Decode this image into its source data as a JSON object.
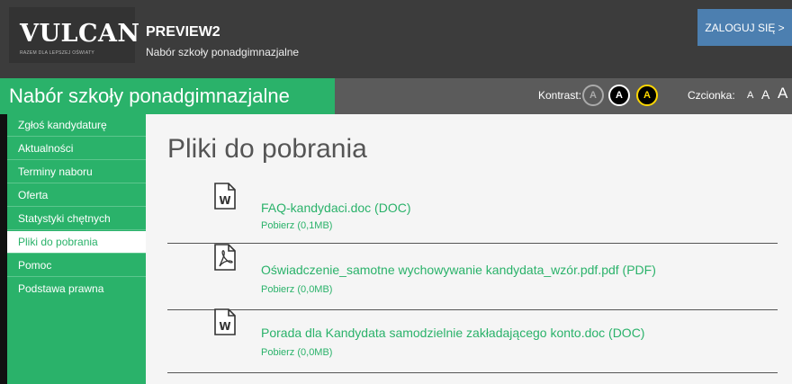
{
  "topbar": {
    "logo_text": "VULCAN",
    "logo_sub": "RAZEM DLA LEPSZEJ OŚWIATY",
    "app_title": "PREVIEW2",
    "app_subtitle": "Nabór szkoły ponadgimnazjalne",
    "login_label": "ZALOGUJ SIĘ >"
  },
  "header": {
    "section_title": "Nabór szkoły ponadgimnazjalne",
    "contrast_label": "Kontrast:",
    "contrast_options": [
      "A",
      "A",
      "A"
    ],
    "font_label": "Czcionka:",
    "font_sizes": [
      "A",
      "A",
      "A"
    ]
  },
  "sidebar": {
    "items": [
      {
        "label": "Zgłoś kandydaturę"
      },
      {
        "label": "Aktualności"
      },
      {
        "label": "Terminy naboru"
      },
      {
        "label": "Oferta"
      },
      {
        "label": "Statystyki chętnych"
      },
      {
        "label": "Pliki do pobrania"
      },
      {
        "label": "Pomoc"
      },
      {
        "label": "Podstawa prawna"
      }
    ],
    "active_index": 5
  },
  "main": {
    "page_title": "Pliki do pobrania",
    "files": [
      {
        "name": "FAQ-kandydaci.doc (DOC)",
        "download": "Pobierz (0,1MB)",
        "icon": "word-doc-icon"
      },
      {
        "name": "Oświadczenie_samotne wychowywanie kandydata_wzór.pdf.pdf (PDF)",
        "download": "Pobierz (0,0MB)",
        "icon": "pdf-icon"
      },
      {
        "name": "Porada dla Kandydata samodzielnie zakładającego konto.doc (DOC)",
        "download": "Pobierz (0,0MB)",
        "icon": "word-doc-icon"
      }
    ]
  },
  "colors": {
    "brand_green": "#2ab26a",
    "topbar": "#3c3c3c",
    "header_gray": "#5b5b5b",
    "login_blue": "#4c7fb0"
  }
}
